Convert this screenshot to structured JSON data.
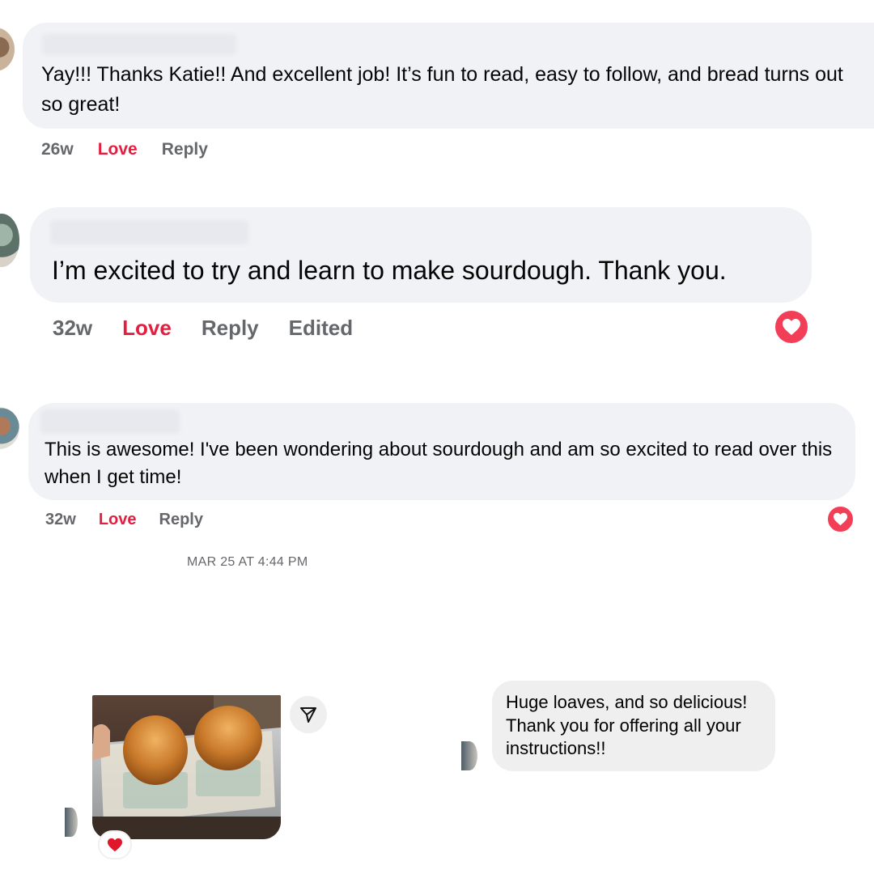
{
  "comments": [
    {
      "text": "Yay!!! Thanks Katie!! And excellent job! It’s fun to read, easy to follow, and bread turns out so great!",
      "age": "26w",
      "love_label": "Love",
      "reply_label": "Reply"
    },
    {
      "text": "I’m excited to try and learn to make sourdough. Thank you.",
      "age": "32w",
      "love_label": "Love",
      "reply_label": "Reply",
      "edited_label": "Edited",
      "reaction": "heart-reaction"
    },
    {
      "text": "This is awesome! I've been wondering about sourdough and am so excited to read over this when I get time!",
      "age": "32w",
      "love_label": "Love",
      "reply_label": "Reply",
      "reaction": "heart-reaction"
    }
  ],
  "chat": {
    "timestamp": "MAR 25 AT 4:44 PM",
    "message": "Huge loaves, and so delicious! Thank you for offering all your instructions!!",
    "photo_reaction": "red-heart",
    "share_icon": "paper-plane-icon"
  },
  "colors": {
    "love": "#e41e3f",
    "bubble": "#f0f2f5",
    "muted": "#65676b",
    "reaction": "#f33e58"
  }
}
